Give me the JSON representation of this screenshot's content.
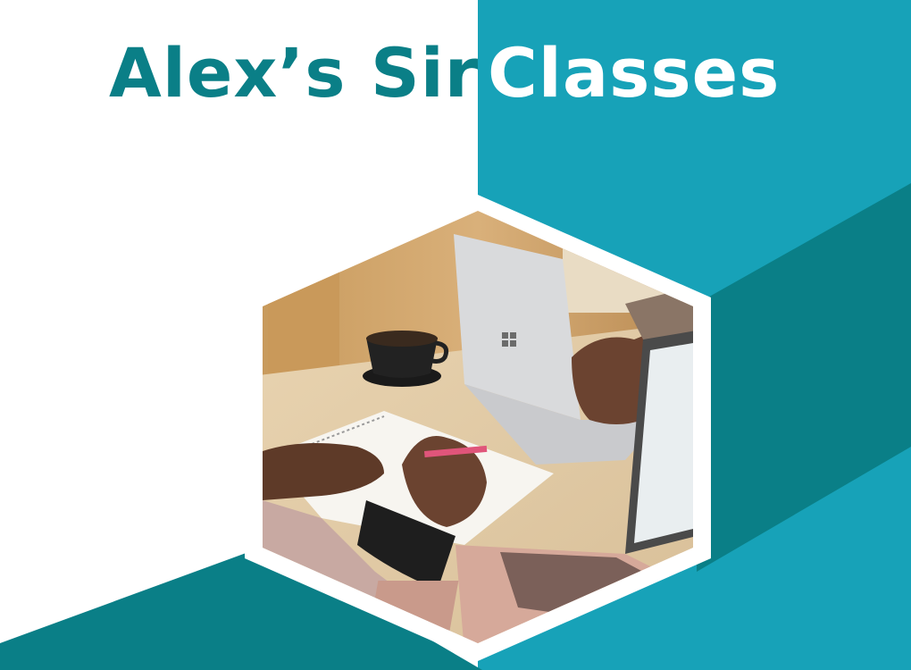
{
  "title": {
    "part1": "Alex’s Sir",
    "part2": "Classes"
  },
  "colors": {
    "teal_dark": "#0a7f87",
    "teal_light": "#17a2b8",
    "white": "#ffffff"
  },
  "photo": {
    "description_icon": "laptop-notebook-photo"
  }
}
